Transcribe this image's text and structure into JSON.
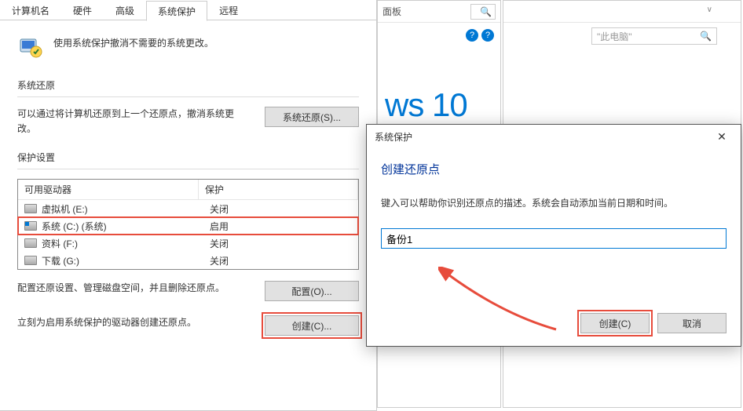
{
  "bg1": {
    "title_fragment": "面板"
  },
  "bg2": {
    "search_placeholder": "\"此电脑\""
  },
  "win10_fragment": "ws 10",
  "tabs": {
    "computer_name": "计算机名",
    "hardware": "硬件",
    "advanced": "高级",
    "system_protection": "系统保护",
    "remote": "远程"
  },
  "intro": "使用系统保护撤消不需要的系统更改。",
  "restore": {
    "title": "系统还原",
    "desc": "可以通过将计算机还原到上一个还原点，撤消系统更改。",
    "button": "系统还原(S)..."
  },
  "protection": {
    "title": "保护设置",
    "col_drive": "可用驱动器",
    "col_protect": "保护",
    "drives": [
      {
        "name": "虚拟机 (E:)",
        "status": "关闭",
        "sys": false,
        "hl": false
      },
      {
        "name": "系统 (C:) (系统)",
        "status": "启用",
        "sys": true,
        "hl": true
      },
      {
        "name": "资料 (F:)",
        "status": "关闭",
        "sys": false,
        "hl": false
      },
      {
        "name": "下载 (G:)",
        "status": "关闭",
        "sys": false,
        "hl": false
      }
    ],
    "configure_desc": "配置还原设置、管理磁盘空间，并且删除还原点。",
    "configure_btn": "配置(O)...",
    "create_desc": "立刻为启用系统保护的驱动器创建还原点。",
    "create_btn": "创建(C)..."
  },
  "modal": {
    "title": "系统保护",
    "heading": "创建还原点",
    "desc": "键入可以帮助你识别还原点的描述。系统会自动添加当前日期和时间。",
    "input_value": "备份1",
    "create": "创建(C)",
    "cancel": "取消"
  }
}
